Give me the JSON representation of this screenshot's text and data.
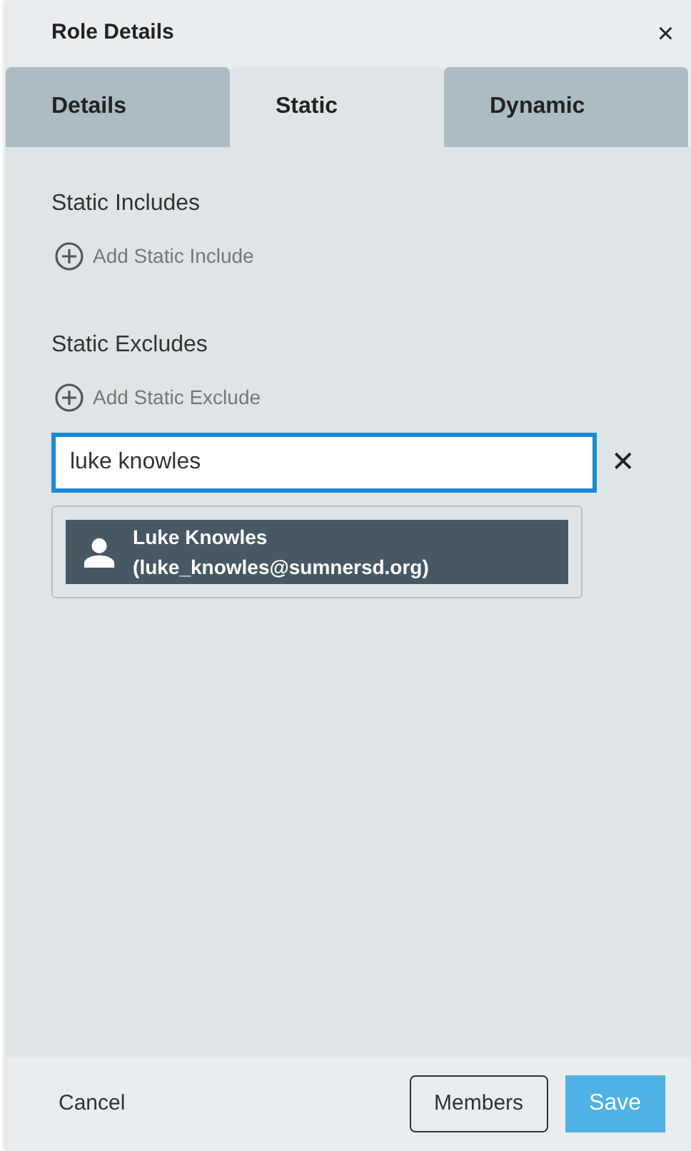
{
  "window": {
    "title": "Role Details",
    "close": "×"
  },
  "tabs": [
    {
      "label": "Details",
      "selected": false
    },
    {
      "label": "Static",
      "selected": true
    },
    {
      "label": "Dynamic",
      "selected": false
    }
  ],
  "sections": [
    {
      "heading": "Static Includes",
      "add_label": "Add Static Include"
    },
    {
      "heading": "Static Excludes",
      "add_label": "Add Static Exclude",
      "search": {
        "value": "luke knowles",
        "clear": "✕",
        "results": [
          {
            "label": "Luke Knowles (luke_knowles@sumnersd.org)",
            "selected": true
          }
        ]
      }
    }
  ],
  "footer": {
    "cancel": "Cancel",
    "members": "Members",
    "save": "Save"
  }
}
